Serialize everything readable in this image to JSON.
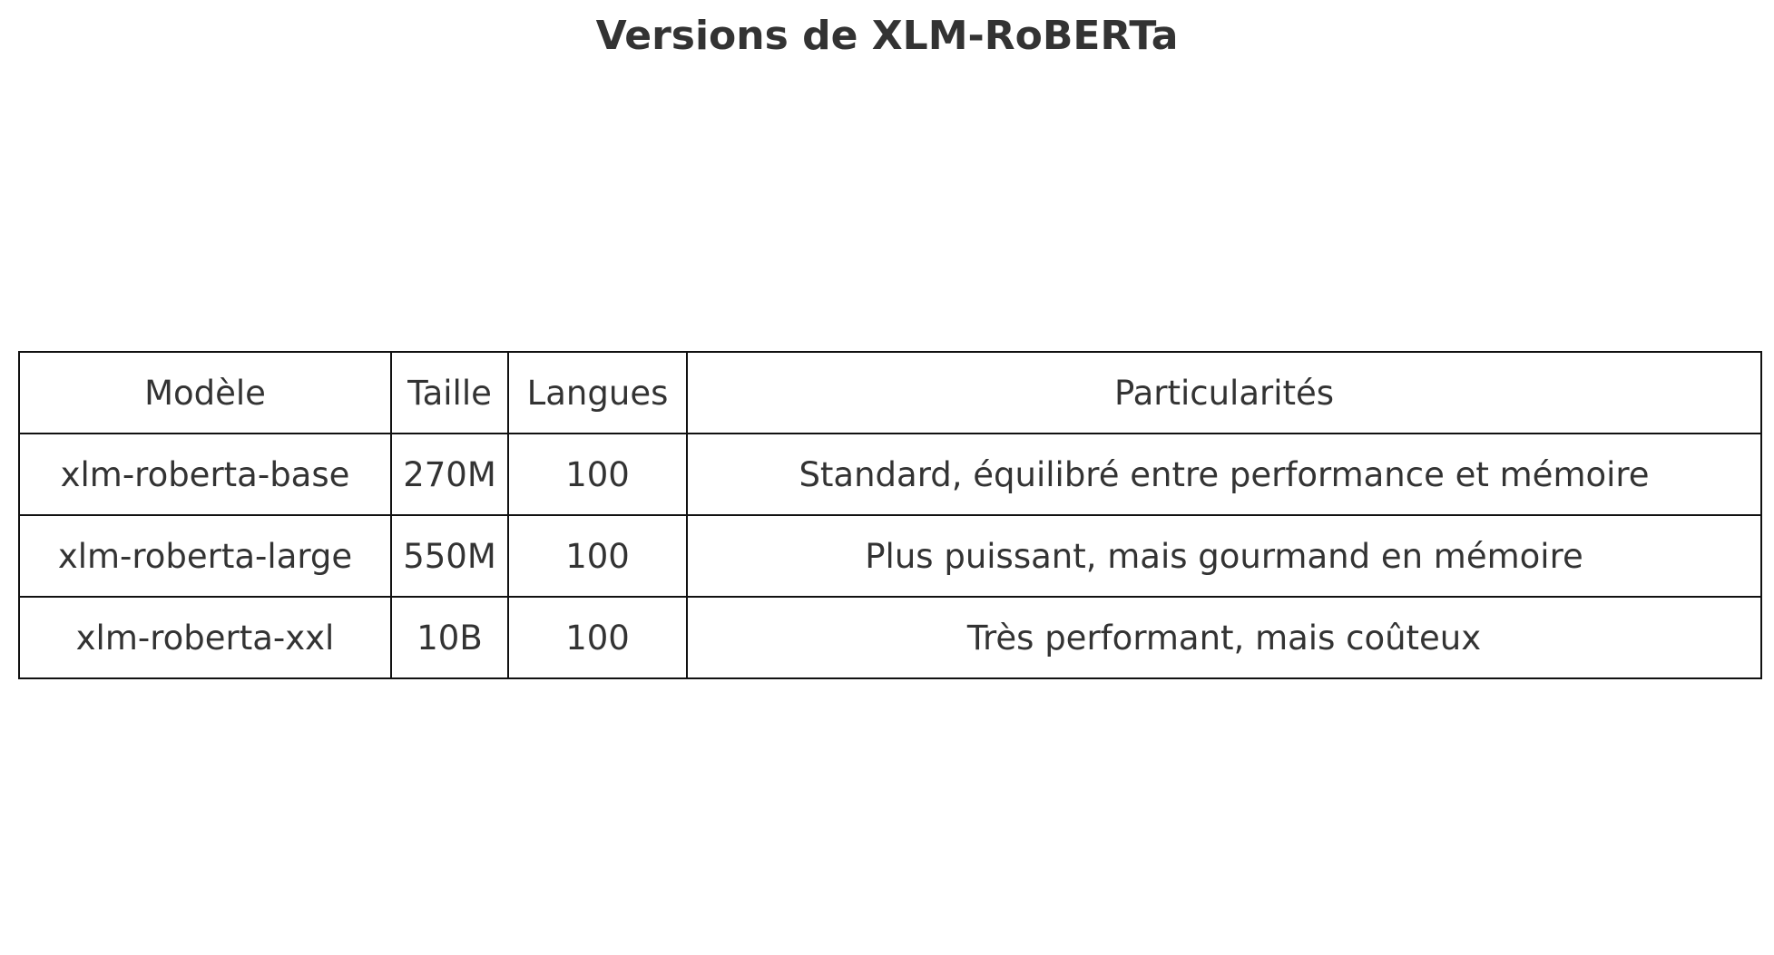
{
  "chart_data": {
    "type": "table",
    "title": "Versions de XLM-RoBERTa",
    "columns": [
      "Modèle",
      "Taille",
      "Langues",
      "Particularités"
    ],
    "rows": [
      [
        "xlm-roberta-base",
        "270M",
        "100",
        "Standard, équilibré entre performance et mémoire"
      ],
      [
        "xlm-roberta-large",
        "550M",
        "100",
        "Plus puissant, mais gourmand en mémoire"
      ],
      [
        "xlm-roberta-xxl",
        "10B",
        "100",
        "Très performant, mais coûteux"
      ]
    ]
  }
}
